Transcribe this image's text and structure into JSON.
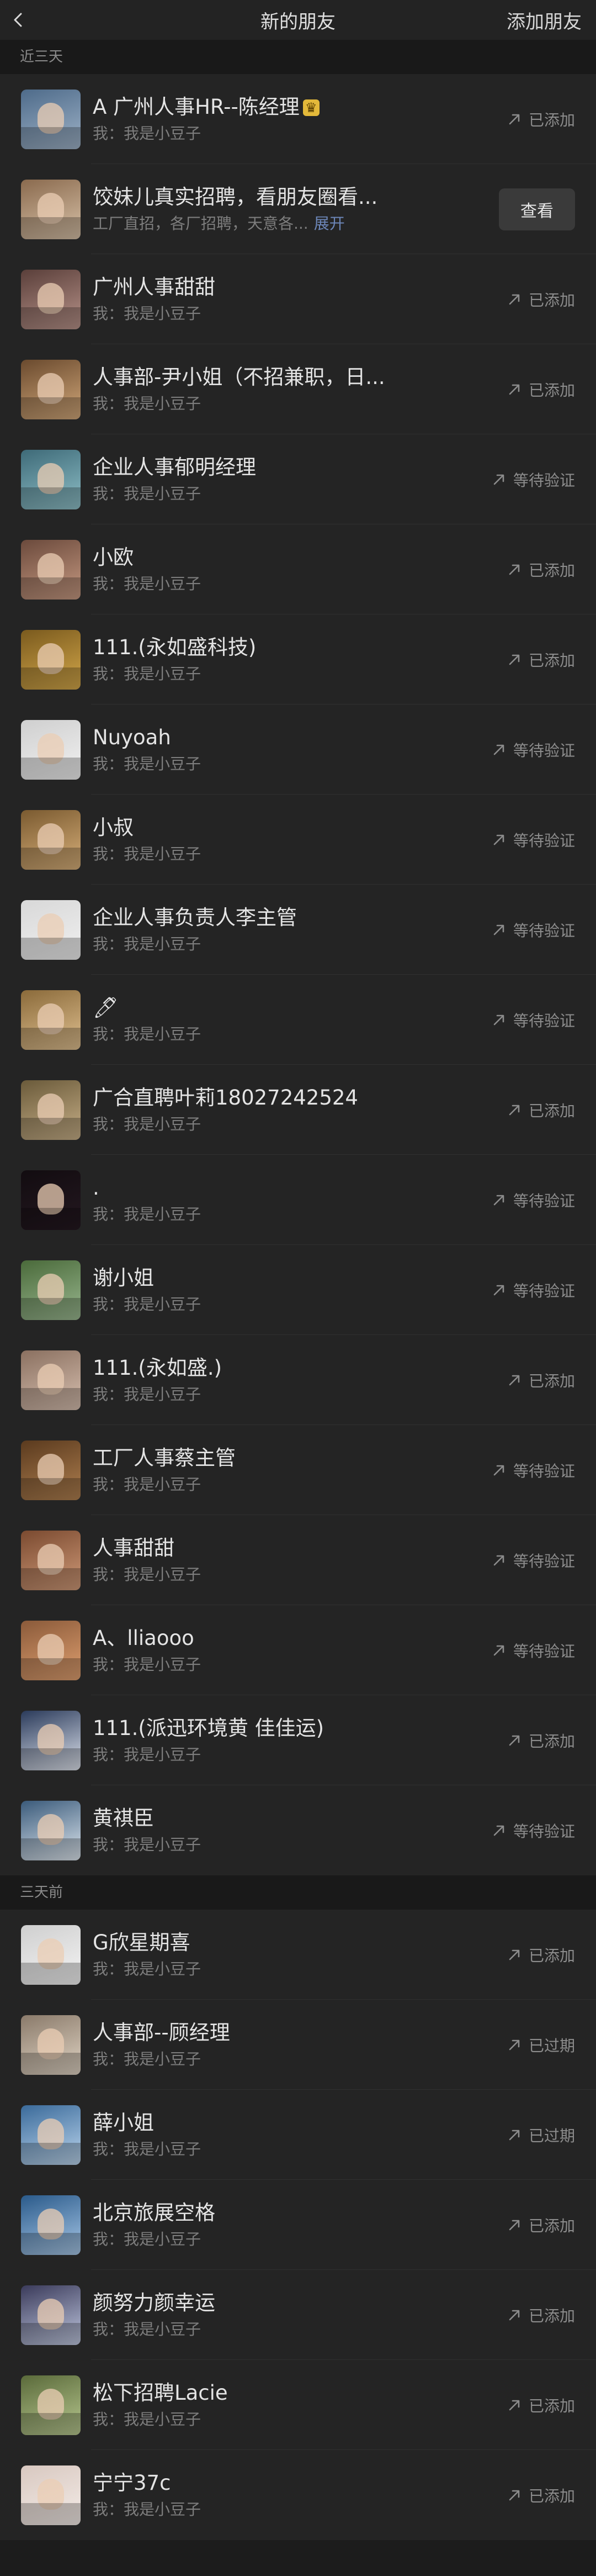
{
  "nav": {
    "title": "新的朋友",
    "add_label": "添加朋友"
  },
  "sections": [
    {
      "title": "近三天",
      "items": [
        {
          "name": "A 广州人事HR--陈经理",
          "badge": true,
          "msg": "我：我是小豆子",
          "status": "已添加",
          "avatar": [
            "#4e6b8a",
            "#9fb3c8"
          ]
        },
        {
          "name": "饺妹儿真实招聘，看朋友圈看...",
          "msg": "工厂直招，各厂招聘，天意各...",
          "expand": "展开",
          "button": "查看",
          "avatar": [
            "#8a6a4e",
            "#d8c2a8"
          ]
        },
        {
          "name": "广州人事甜甜",
          "msg": "我：我是小豆子",
          "status": "已添加",
          "avatar": [
            "#5a3f3a",
            "#b8938a"
          ]
        },
        {
          "name": "人事部-尹小姐（不招兼职，日...",
          "msg": "我：我是小豆子",
          "status": "已添加",
          "avatar": [
            "#6a4a2e",
            "#d2a87a"
          ]
        },
        {
          "name": "企业人事郁明经理",
          "msg": "我：我是小豆子",
          "status": "等待验证",
          "avatar": [
            "#3e6a78",
            "#8fc0c8"
          ]
        },
        {
          "name": "小欧",
          "msg": "我：我是小豆子",
          "status": "已添加",
          "avatar": [
            "#6b4a3c",
            "#c79a82"
          ]
        },
        {
          "name": "111.(永如盛科技)",
          "msg": "我：我是小豆子",
          "status": "已添加",
          "avatar": [
            "#7a5a1e",
            "#d4a84a"
          ]
        },
        {
          "name": "Nuyoah",
          "msg": "我：我是小豆子",
          "status": "等待验证",
          "avatar": [
            "#cfcfcf",
            "#f2f2f2"
          ]
        },
        {
          "name": "小叔",
          "msg": "我：我是小豆子",
          "status": "等待验证",
          "avatar": [
            "#7a5a30",
            "#d8b07a"
          ]
        },
        {
          "name": "企业人事负责人李主管",
          "msg": "我：我是小豆子",
          "status": "等待验证",
          "avatar": [
            "#d8d8d8",
            "#f0f0f0"
          ]
        },
        {
          "name": "🖊",
          "msg": "我：我是小豆子",
          "status": "等待验证",
          "avatar": [
            "#8a6a3a",
            "#e0c090"
          ]
        },
        {
          "name": "广合直聘叶莉18027242524",
          "msg": "我：我是小豆子",
          "status": "已添加",
          "avatar": [
            "#6a5a3a",
            "#c8b088"
          ]
        },
        {
          "name": ".",
          "msg": "我：我是小豆子",
          "status": "等待验证",
          "avatar": [
            "#120c10",
            "#241820"
          ]
        },
        {
          "name": "谢小姐",
          "msg": "我：我是小豆子",
          "status": "等待验证",
          "avatar": [
            "#4a6a3a",
            "#9ab890"
          ]
        },
        {
          "name": "111.(永如盛.)",
          "msg": "我：我是小豆子",
          "status": "已添加",
          "avatar": [
            "#8a7060",
            "#d8c0b0"
          ]
        },
        {
          "name": "工厂人事蔡主管",
          "msg": "我：我是小豆子",
          "status": "等待验证",
          "avatar": [
            "#5a3a1e",
            "#b08050"
          ]
        },
        {
          "name": "人事甜甜",
          "msg": "我：我是小豆子",
          "status": "等待验证",
          "avatar": [
            "#7a4a30",
            "#d09a78"
          ]
        },
        {
          "name": "A、lliaooo",
          "msg": "我：我是小豆子",
          "status": "等待验证",
          "avatar": [
            "#8a5a3a",
            "#e0a070"
          ]
        },
        {
          "name": "111.(派迅环境黄 佳佳运)",
          "msg": "我：我是小豆子",
          "status": "已添加",
          "avatar": [
            "#2a3a5a",
            "#dfe4ee"
          ]
        },
        {
          "name": "黄祺臣",
          "msg": "我：我是小豆子",
          "status": "等待验证",
          "avatar": [
            "#3a5a7a",
            "#dfe8f0"
          ]
        }
      ]
    },
    {
      "title": "三天前",
      "items": [
        {
          "name": "G欣星期喜",
          "msg": "我：我是小豆子",
          "status": "已添加",
          "avatar": [
            "#cfcfcf",
            "#f4f4f4"
          ]
        },
        {
          "name": "人事部--顾经理",
          "msg": "我：我是小豆子",
          "status": "已过期",
          "avatar": [
            "#8a7a6a",
            "#e0d4c4"
          ]
        },
        {
          "name": "薛小姐",
          "msg": "我：我是小豆子",
          "status": "已过期",
          "avatar": [
            "#3a6a9a",
            "#bcd6ee"
          ]
        },
        {
          "name": "北京旅展空格",
          "msg": "我：我是小豆子",
          "status": "已添加",
          "avatar": [
            "#2a5a8a",
            "#a8c8e8"
          ]
        },
        {
          "name": "颜努力颜幸运",
          "msg": "我：我是小豆子",
          "status": "已添加",
          "avatar": [
            "#3a3a5a",
            "#c0c8e0"
          ]
        },
        {
          "name": "松下招聘Lacie",
          "msg": "我：我是小豆子",
          "status": "已添加",
          "avatar": [
            "#5a6a3a",
            "#b8c890"
          ]
        },
        {
          "name": "宁宁37c",
          "msg": "我：我是小豆子",
          "status": "已添加",
          "avatar": [
            "#d8c8c0",
            "#f4ece8"
          ]
        }
      ]
    }
  ]
}
